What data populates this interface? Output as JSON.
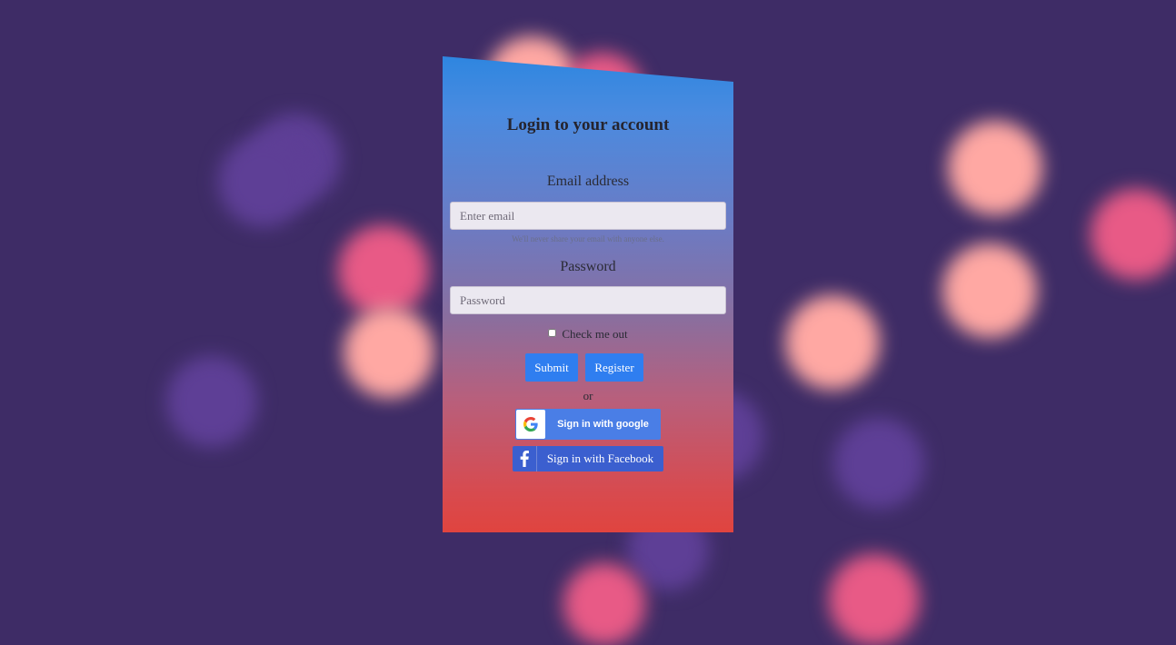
{
  "login": {
    "title": "Login to your account",
    "email_label": "Email address",
    "email_placeholder": "Enter email",
    "email_help": "We'll never share your email with anyone else.",
    "password_label": "Password",
    "password_placeholder": "Password",
    "remember_label": "Check me out",
    "submit_label": "Submit",
    "register_label": "Register",
    "or_text": "or",
    "google_label": "Sign in with google",
    "facebook_label": "Sign in with Facebook"
  },
  "icons": {
    "google": "google-icon",
    "facebook": "facebook-icon"
  },
  "colors": {
    "background": "#3e2c66",
    "button": "#2f7ef0",
    "google_button": "#4a7ee6",
    "facebook_button": "#3b5fcf",
    "gradient_top": "#2e86e0",
    "gradient_bottom": "#e0443f"
  }
}
